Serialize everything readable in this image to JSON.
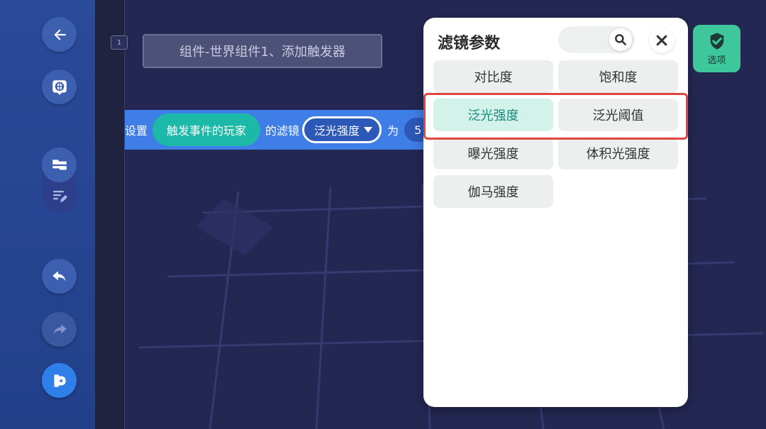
{
  "colors": {
    "sidebar": "#2a4a9a",
    "editor_bg": "#242751",
    "code_block": "#3f7ee6",
    "player_pill": "#1cb8a8",
    "panel_bg": "#ffffff",
    "selected_option": "#d2f2ea",
    "highlight_box": "#e0463f",
    "options_button": "#3ec79a"
  },
  "sidebar": {
    "buttons": [
      {
        "name": "back",
        "icon": "arrow-left-icon"
      },
      {
        "name": "world",
        "icon": "globe-icon"
      },
      {
        "name": "blocks",
        "icon": "blocks-icon"
      },
      {
        "name": "notes",
        "icon": "notes-icon"
      },
      {
        "name": "undo",
        "icon": "undo-icon"
      },
      {
        "name": "redo",
        "icon": "redo-icon"
      },
      {
        "name": "run",
        "icon": "play-icon"
      }
    ]
  },
  "editor": {
    "line_number": "1",
    "comment_text": "组件-世界组件1、添加触发器",
    "code_block": {
      "prefix": "设置",
      "player": "触发事件的玩家",
      "middle": "的滤镜",
      "filter": "泛光强度",
      "suffix": "为",
      "value": "5"
    }
  },
  "filter_panel": {
    "title": "滤镜参数",
    "search_placeholder": "",
    "options": [
      {
        "label": "对比度",
        "selected": false
      },
      {
        "label": "饱和度",
        "selected": false
      },
      {
        "label": "泛光强度",
        "selected": true
      },
      {
        "label": "泛光阈值",
        "selected": false
      },
      {
        "label": "曝光强度",
        "selected": false
      },
      {
        "label": "体积光强度",
        "selected": false
      },
      {
        "label": "伽马强度",
        "selected": false
      }
    ]
  },
  "options_button": {
    "label": "选项",
    "icon": "check-shield-icon"
  }
}
